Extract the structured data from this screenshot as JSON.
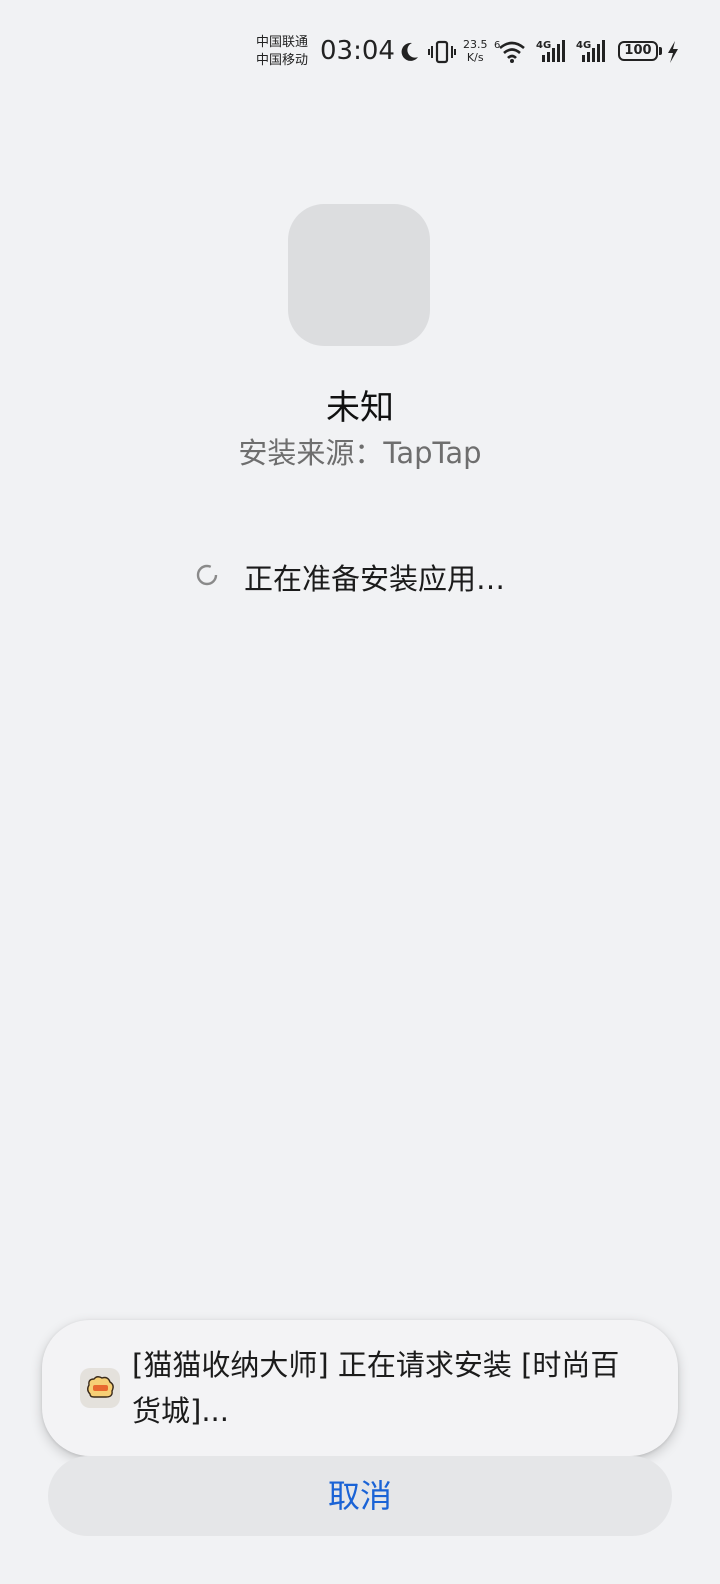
{
  "status_bar": {
    "carrier_1": "中国联通",
    "carrier_2": "中国移动",
    "time": "03:04",
    "net_speed_value": "23.5",
    "net_speed_unit": "K/s",
    "wifi_gen": "6",
    "signal_1_type": "4G",
    "signal_2_type": "4G",
    "battery_level": "100",
    "icons": [
      "moon-icon",
      "vibrate-icon",
      "wifi-icon",
      "signal-icon",
      "signal-icon",
      "battery-icon",
      "charging-icon"
    ]
  },
  "app": {
    "name": "未知",
    "source": "安装来源：TapTap"
  },
  "progress": {
    "text": "正在准备安装应用…"
  },
  "toast": {
    "message": "[猫猫收纳大师] 正在请求安装 [时尚百货城]..."
  },
  "actions": {
    "cancel_label": "取消"
  },
  "colors": {
    "background": "#f1f2f4",
    "accent": "#1a63d6",
    "icon_placeholder": "#dcdddf"
  }
}
